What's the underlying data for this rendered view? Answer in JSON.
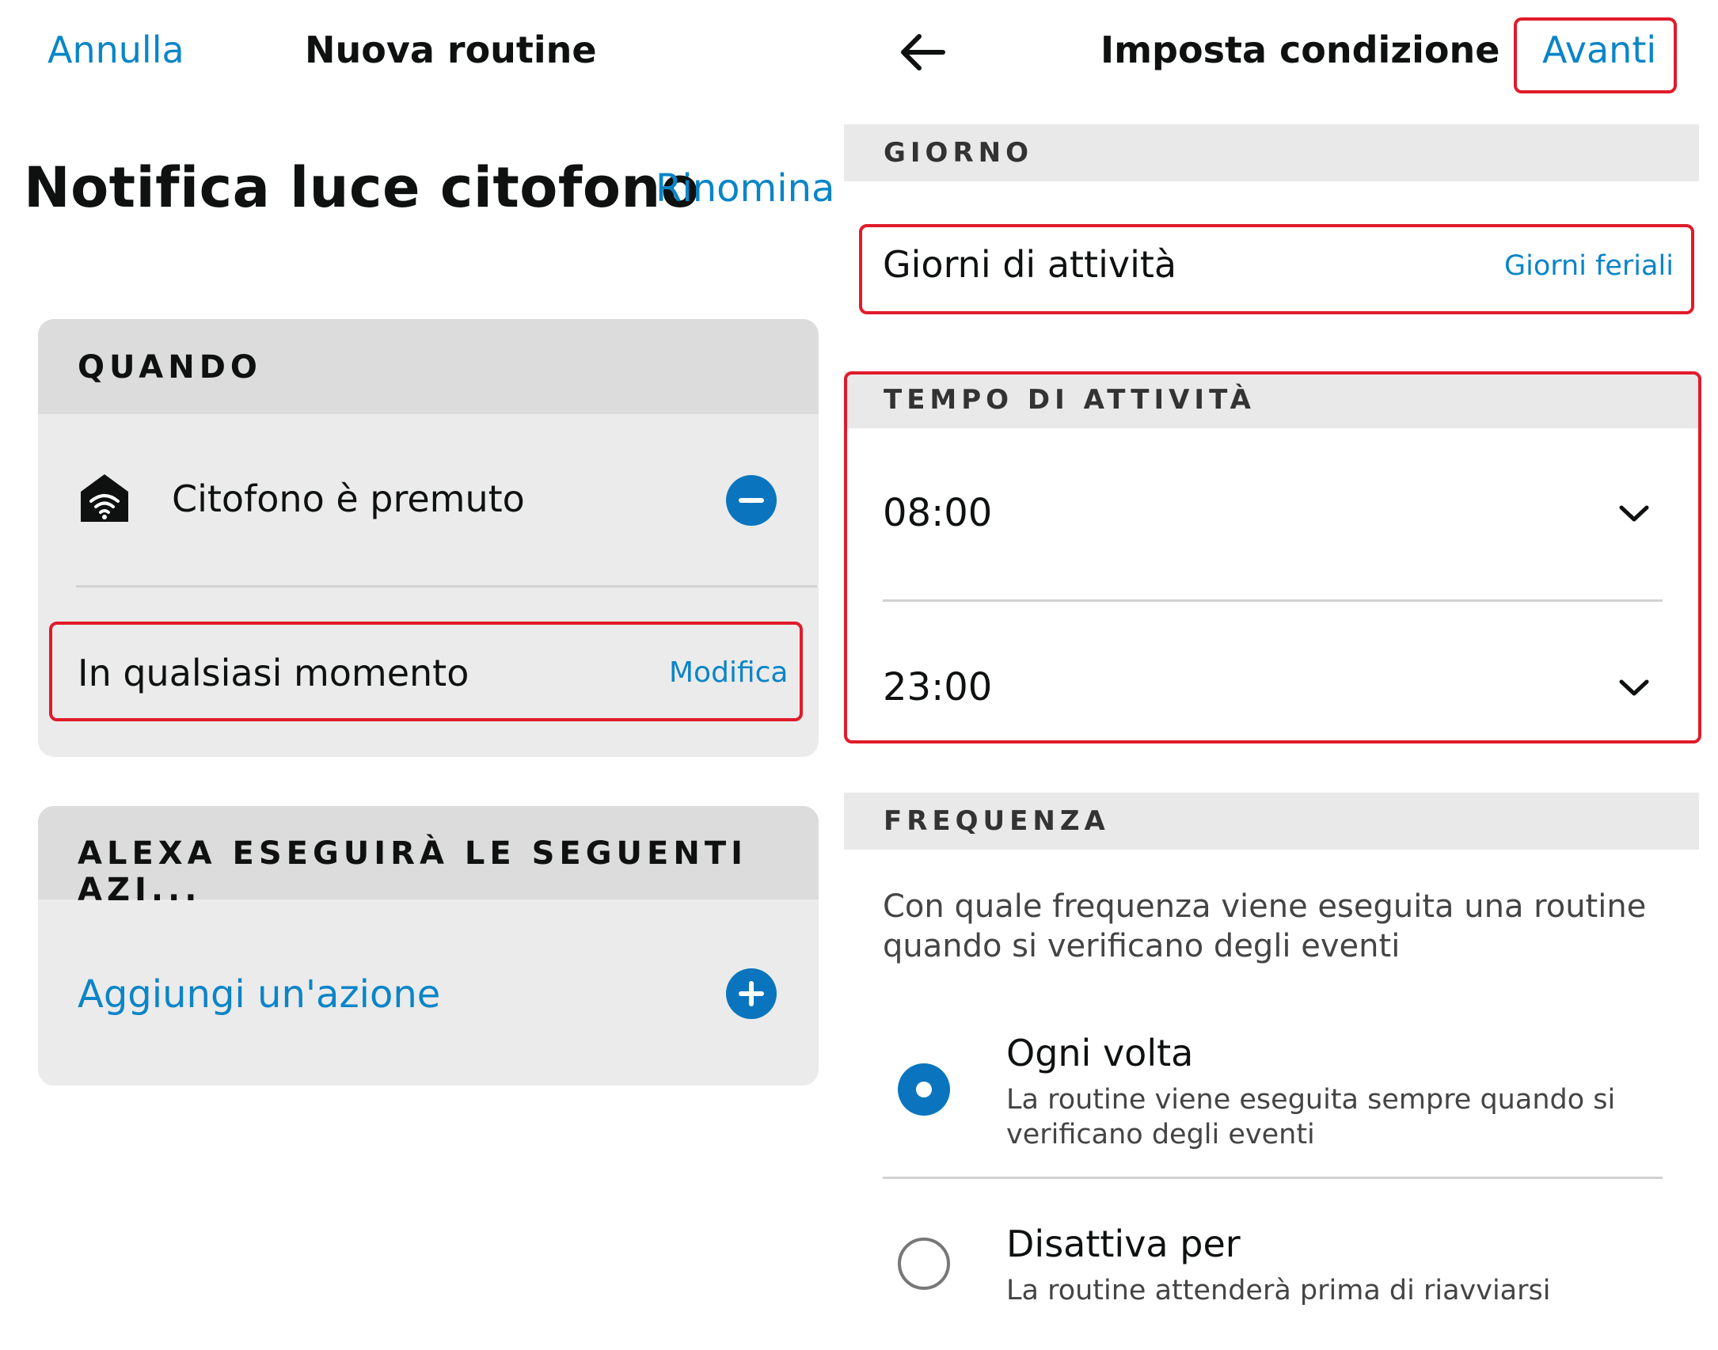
{
  "left": {
    "cancel_label": "Annulla",
    "screen_title": "Nuova routine",
    "routine_name": "Notifica luce citofono",
    "rename_label": "Rinomina",
    "when_section": {
      "header": "QUANDO",
      "trigger_label": "Citofono è premuto",
      "trigger_icon": "doorbell-wifi-icon",
      "time_label": "In qualsiasi momento",
      "modify_label": "Modifica"
    },
    "actions_section": {
      "header": "ALEXA ESEGUIRÀ LE SEGUENTI AZI...",
      "add_action_label": "Aggiungi un'azione"
    }
  },
  "right": {
    "screen_title": "Imposta condizione",
    "next_label": "Avanti",
    "day_section": {
      "header": "GIORNO",
      "days_label": "Giorni di attività",
      "days_value": "Giorni feriali"
    },
    "time_section": {
      "header": "TEMPO DI ATTIVITÀ",
      "start_time": "08:00",
      "end_time": "23:00"
    },
    "frequency_section": {
      "header": "FREQUENZA",
      "description": "Con quale frequenza viene eseguita una routine quando si verificano degli eventi",
      "options": [
        {
          "title": "Ogni volta",
          "description": "La routine viene eseguita sempre quando si verificano degli eventi",
          "selected": true
        },
        {
          "title": "Disattiva per",
          "description": "La routine attenderà prima di riavviarsi",
          "selected": false
        }
      ]
    }
  },
  "colors": {
    "accent": "#0a85c7",
    "highlight": "#e01b2a",
    "card_background": "#ebebeb",
    "section_header": "#e9e9e9"
  }
}
